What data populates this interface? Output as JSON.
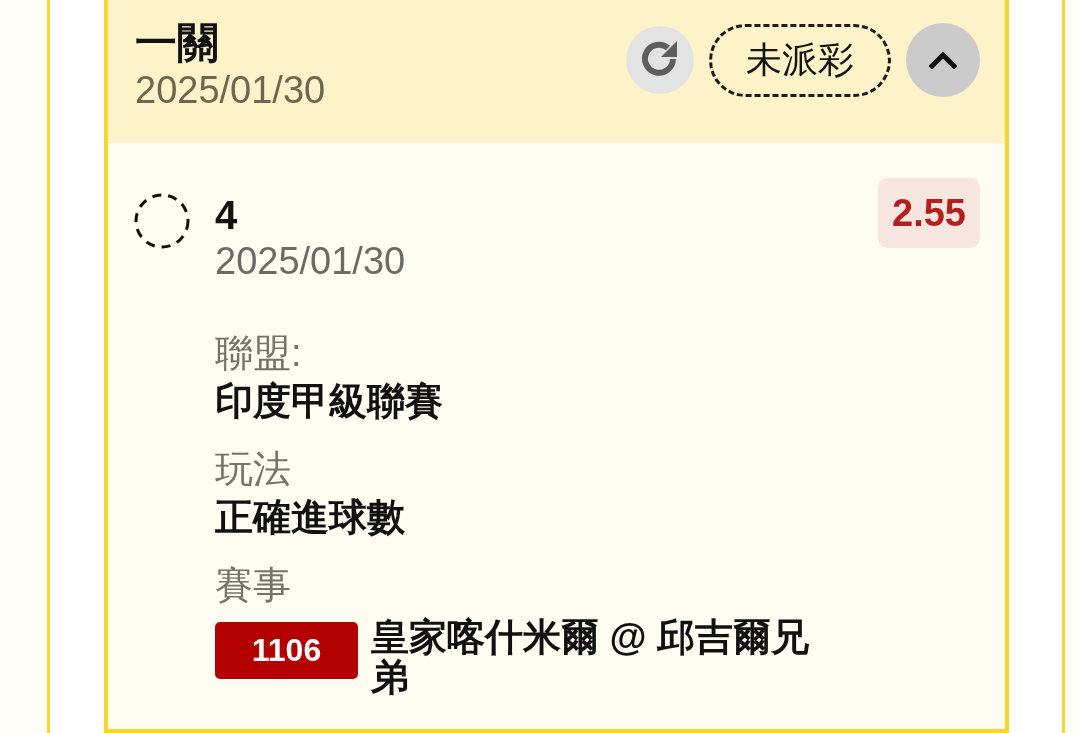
{
  "ticket": {
    "title": "一關",
    "date": "2025/01/30",
    "status": "未派彩",
    "settled": false,
    "expanded": true
  },
  "legs": [
    {
      "selection": "4",
      "date": "2025/01/30",
      "settled": false,
      "odds": "2.55",
      "details": [
        {
          "label": "聯盟:",
          "value": "印度甲級聯賽"
        },
        {
          "label": "玩法",
          "value": "正確進球數"
        }
      ],
      "event": {
        "label": "賽事",
        "code": "1106",
        "match": "皇家喀什米爾 @ 邱吉爾兄弟"
      }
    }
  ]
}
